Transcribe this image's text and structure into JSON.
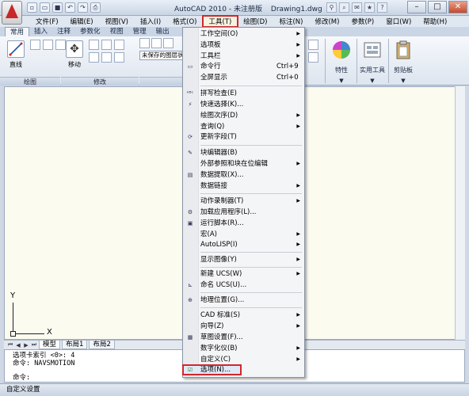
{
  "title_bar": {
    "app": "AutoCAD 2010 - 未注册版",
    "file": "Drawing1.dwg"
  },
  "menubar": [
    "文件(F)",
    "编辑(E)",
    "视图(V)",
    "插入(I)",
    "格式(O)",
    "工具(T)",
    "绘图(D)",
    "标注(N)",
    "修改(M)",
    "参数(P)",
    "窗口(W)",
    "帮助(H)"
  ],
  "ribbon_tabs": [
    "常用",
    "插入",
    "注释",
    "参数化",
    "视图",
    "管理",
    "输出"
  ],
  "ribbon": {
    "line_label": "直线",
    "move_label": "移动",
    "layer_state": "未保存的图层状",
    "draw_panel": "绘图",
    "modify_panel": "修改",
    "properties_label": "特性",
    "utilities_label": "实用工具",
    "clipboard_label": "剪贴板"
  },
  "tools_menu": {
    "items": [
      {
        "label": "工作空间(O)",
        "submenu": true
      },
      {
        "label": "选项板",
        "submenu": true
      },
      {
        "label": "工具栏",
        "submenu": true
      },
      {
        "label": "命令行",
        "shortcut": "Ctrl+9",
        "icon": "command-line-icon"
      },
      {
        "label": "全屏显示",
        "shortcut": "Ctrl+0"
      },
      {
        "label": "拼写检查(E)",
        "icon": "spell-check-icon"
      },
      {
        "label": "快速选择(K)...",
        "icon": "quick-select-icon"
      },
      {
        "label": "绘图次序(D)",
        "submenu": true
      },
      {
        "label": "查询(Q)",
        "submenu": true
      },
      {
        "label": "更新字段(T)",
        "icon": "update-fields-icon"
      },
      {
        "label": "块编辑器(B)",
        "icon": "block-editor-icon"
      },
      {
        "label": "外部参照和块在位编辑",
        "submenu": true
      },
      {
        "label": "数据提取(X)...",
        "icon": "data-extraction-icon"
      },
      {
        "label": "数据链接",
        "submenu": true
      },
      {
        "label": "动作录制器(T)",
        "submenu": true
      },
      {
        "label": "加载应用程序(L)...",
        "icon": "load-app-icon"
      },
      {
        "label": "运行脚本(R)...",
        "icon": "run-script-icon"
      },
      {
        "label": "宏(A)",
        "submenu": true
      },
      {
        "label": "AutoLISP(I)",
        "submenu": true
      },
      {
        "label": "显示图像(Y)",
        "submenu": true
      },
      {
        "label": "新建 UCS(W)",
        "submenu": true
      },
      {
        "label": "命名 UCS(U)...",
        "icon": "named-ucs-icon"
      },
      {
        "label": "地理位置(G)...",
        "icon": "geo-location-icon"
      },
      {
        "label": "CAD 标准(S)",
        "submenu": true
      },
      {
        "label": "向导(Z)",
        "submenu": true
      },
      {
        "label": "草图设置(F)...",
        "icon": "drafting-settings-icon"
      },
      {
        "label": "数字化仪(B)",
        "submenu": true
      },
      {
        "label": "自定义(C)",
        "submenu": true
      },
      {
        "label": "选项(N)...",
        "icon": "options-icon",
        "highlighted": true
      }
    ]
  },
  "canvas": {
    "ucs_x": "X",
    "ucs_y": "Y"
  },
  "layout_tabs": [
    "模型",
    "布局1",
    "布局2"
  ],
  "command_line": {
    "line1": "选项卡索引 <0>: 4",
    "line2": "命令: NAVSMOTION",
    "prompt": "命令:"
  },
  "status_bar": "自定义设置",
  "colors": {
    "highlight_outline": "#d3262c",
    "canvas_bg": "#fcfbf0"
  }
}
